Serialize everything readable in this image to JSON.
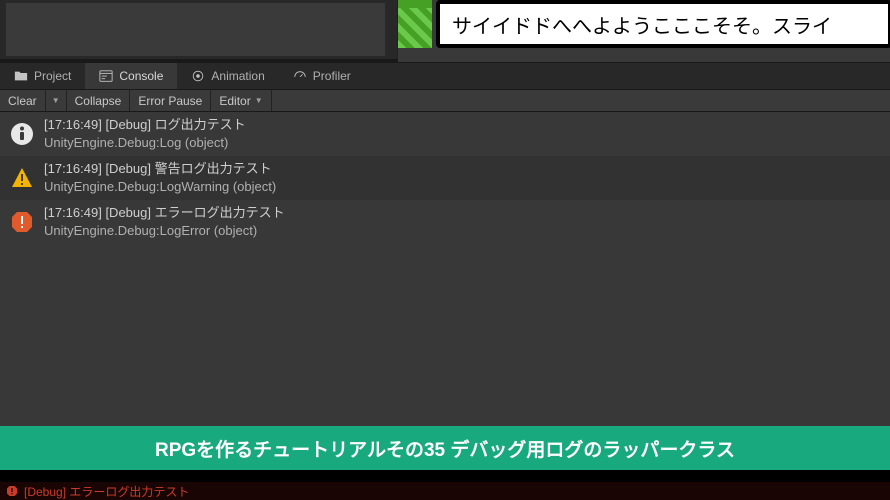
{
  "game_view": {
    "dialog_text": "サイイドドへへよようこここそそ。スライ"
  },
  "tabs": {
    "project": {
      "label": "Project"
    },
    "console": {
      "label": "Console"
    },
    "animation": {
      "label": "Animation"
    },
    "profiler": {
      "label": "Profiler"
    }
  },
  "toolbar": {
    "clear": "Clear",
    "collapse": "Collapse",
    "error_pause": "Error Pause",
    "editor": "Editor"
  },
  "logs": [
    {
      "type": "info",
      "line1": "[17:16:49] [Debug] ログ出力テスト",
      "line2": "UnityEngine.Debug:Log (object)"
    },
    {
      "type": "warning",
      "line1": "[17:16:49] [Debug] 警告ログ出力テスト",
      "line2": "UnityEngine.Debug:LogWarning (object)"
    },
    {
      "type": "error",
      "line1": "[17:16:49] [Debug] エラーログ出力テスト",
      "line2": "UnityEngine.Debug:LogError (object)"
    }
  ],
  "banner": {
    "text": "RPGを作るチュートリアルその35 デバッグ用ログのラッパークラス"
  },
  "status_bar": {
    "text": "[Debug] エラーログ出力テスト"
  }
}
